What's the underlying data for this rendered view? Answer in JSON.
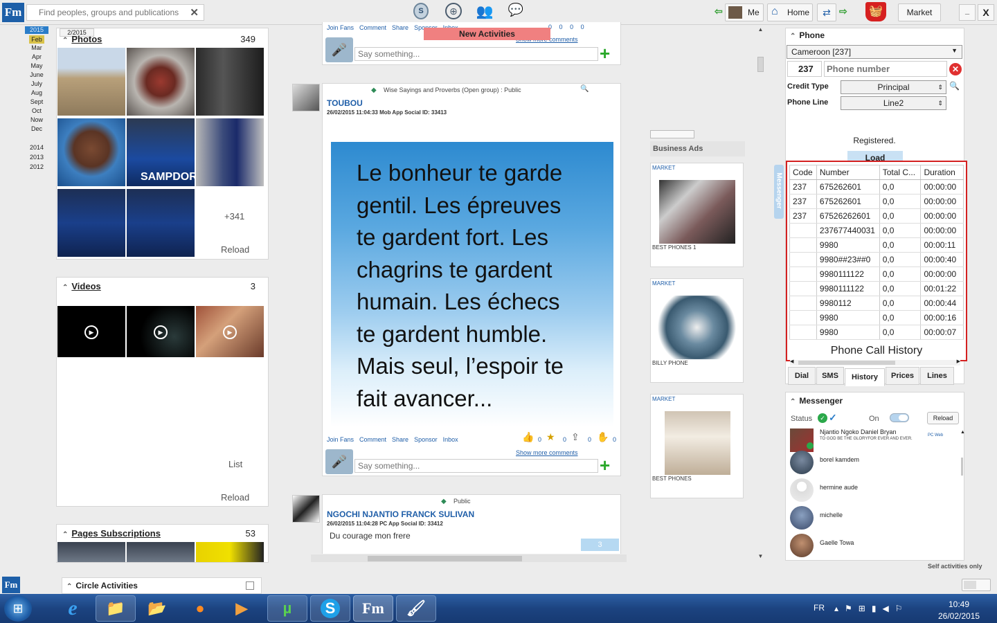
{
  "topbar": {
    "search_placeholder": "Find peoples, groups and publications",
    "me_label": "Me",
    "home_label": "Home",
    "market_label": "Market",
    "new_activities": "New Activities"
  },
  "years": {
    "current_year": "2015",
    "months": [
      "Feb",
      "Mar",
      "Apr",
      "May",
      "June",
      "July",
      "Aug",
      "Sept",
      "Oct",
      "Now",
      "Dec"
    ],
    "other_years": [
      "2014",
      "2013",
      "2012"
    ],
    "date_label": "2/2015"
  },
  "photos": {
    "title": "Photos",
    "count": "349",
    "more": "+341",
    "reload": "Reload"
  },
  "videos": {
    "title": "Videos",
    "count": "3",
    "list": "List",
    "reload": "Reload"
  },
  "pages": {
    "title": "Pages Subscriptions",
    "count": "53"
  },
  "circle": {
    "title": "Circle Activities"
  },
  "post_top": {
    "actions": [
      "Join Fans",
      "Comment",
      "Share",
      "Sponsor",
      "Inbox"
    ],
    "counts": [
      "0",
      "0",
      "0",
      "0"
    ],
    "show_more": "Show more comments",
    "say_placeholder": "Say something..."
  },
  "post1": {
    "group": "Wise Sayings and Proverbs (Open group) : Public",
    "author": "TOUBOU",
    "meta": "26/02/2015 11:04:33  Mob App  Social ID: 33413",
    "quote_lines": [
      "Le bonheur te garde",
      "gentil. Les épreuves",
      "te gardent fort. Les",
      "chagrins te gardent",
      "humain. Les échecs",
      "te gardent humble.",
      "Mais seul, l’espoir te",
      "fait avancer..."
    ],
    "actions": [
      "Join Fans",
      "Comment",
      "Share",
      "Sponsor",
      "Inbox"
    ],
    "counts": [
      "0",
      "0",
      "0",
      "0"
    ],
    "show_more": "Show more comments",
    "say_placeholder": "Say something..."
  },
  "post2": {
    "visibility": "Public",
    "author": "NGOCHI NJANTIO FRANCK SULIVAN",
    "meta": "26/02/2015 11:04:28  PC App  Social ID: 33412",
    "text": "Du courage mon frere",
    "badge": "3"
  },
  "ads": {
    "title": "Business Ads",
    "items": [
      {
        "tag": "MARKET",
        "name": "BEST PHONES 1"
      },
      {
        "tag": "MARKET",
        "name": "BILLY PHONE"
      },
      {
        "tag": "MARKET",
        "name": "BEST PHONES"
      }
    ]
  },
  "messenger_tab": "Messenger",
  "phone": {
    "title": "Phone",
    "country": "Cameroon [237]",
    "code": "237",
    "number_placeholder": "Phone number",
    "credit_type_label": "Credit Type",
    "credit_type": "Principal",
    "phone_line_label": "Phone Line",
    "phone_line": "Line2",
    "status": "Registered.",
    "load": "Load",
    "columns": [
      "Code",
      "Number",
      "Total C...",
      "Duration"
    ],
    "rows": [
      [
        "237",
        "675262601",
        "0,0",
        "00:00:00"
      ],
      [
        "237",
        "675262601",
        "0,0",
        "00:00:00"
      ],
      [
        "237",
        "67526262601",
        "0,0",
        "00:00:00"
      ],
      [
        "",
        "237677440031",
        "0,0",
        "00:00:00"
      ],
      [
        "",
        "9980",
        "0,0",
        "00:00:11"
      ],
      [
        "",
        "9980##23##0",
        "0,0",
        "00:00:40"
      ],
      [
        "",
        "9980111122",
        "0,0",
        "00:00:00"
      ],
      [
        "",
        "9980111122",
        "0,0",
        "00:01:22"
      ],
      [
        "",
        "9980112",
        "0,0",
        "00:00:44"
      ],
      [
        "",
        "9980",
        "0,0",
        "00:00:16"
      ],
      [
        "",
        "9980",
        "0,0",
        "00:00:07"
      ]
    ],
    "history_caption": "Phone Call History",
    "tabs": [
      "Dial",
      "SMS",
      "History",
      "Prices",
      "Lines"
    ],
    "active_tab": "History"
  },
  "messenger": {
    "title": "Messenger",
    "status_label": "Status",
    "on_label": "On",
    "reload": "Reload",
    "contacts": [
      {
        "name": "Njantio Ngoko Daniel Bryan",
        "sub": "TO GOD BE THE GLORYFOR EVER AND EVER.",
        "badge": "PC Web"
      },
      {
        "name": "borel kamdem",
        "sub": "",
        "badge": ""
      },
      {
        "name": "hermine aude",
        "sub": "",
        "badge": ""
      },
      {
        "name": "michelle",
        "sub": "",
        "badge": ""
      },
      {
        "name": "Gaelle Towa",
        "sub": "",
        "badge": ""
      }
    ]
  },
  "self_activities": "Self activities only",
  "taskbar": {
    "lang": "FR",
    "time": "10:49",
    "date": "26/02/2015"
  }
}
